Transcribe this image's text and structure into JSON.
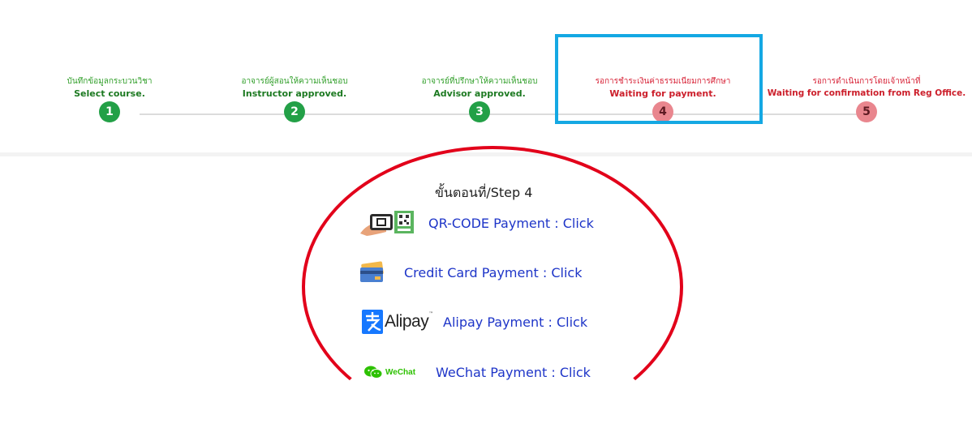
{
  "steps": [
    {
      "th": "บันทึกข้อมูลกระบวนวิชา",
      "en": "Select course.",
      "number": "1",
      "status": "done"
    },
    {
      "th": "อาจารย์ผู้สอนให้ความเห็นชอบ",
      "en": "Instructor approved.",
      "number": "2",
      "status": "done"
    },
    {
      "th": "อาจารย์ที่ปรึกษาให้ความเห็นชอบ",
      "en": "Advisor approved.",
      "number": "3",
      "status": "done"
    },
    {
      "th": "รอการชำระเงินค่าธรรมเนียมการศึกษา",
      "en": "Waiting for payment.",
      "number": "4",
      "status": "pending"
    },
    {
      "th": "รอการดำเนินการโดยเจ้าหน้าที่",
      "en": "Waiting for confirmation from Reg Office.",
      "number": "5",
      "status": "pending"
    }
  ],
  "step_heading": "ขั้นตอนที่/Step 4",
  "payments": [
    {
      "label": "QR-CODE Payment : Click",
      "icon": "qr-code-icon"
    },
    {
      "label": "Credit Card Payment : Click",
      "icon": "credit-card-icon"
    },
    {
      "label": "Alipay Payment : Click",
      "icon": "alipay-icon",
      "logo_text": "Alipay"
    },
    {
      "label": "WeChat Payment : Click",
      "icon": "wechat-icon",
      "logo_text": "WeChat"
    }
  ],
  "colors": {
    "done": "#23a047",
    "pending": "#e9868e",
    "link": "#1e35c8",
    "highlight": "#14a8e3",
    "annotation": "#e2001a"
  }
}
